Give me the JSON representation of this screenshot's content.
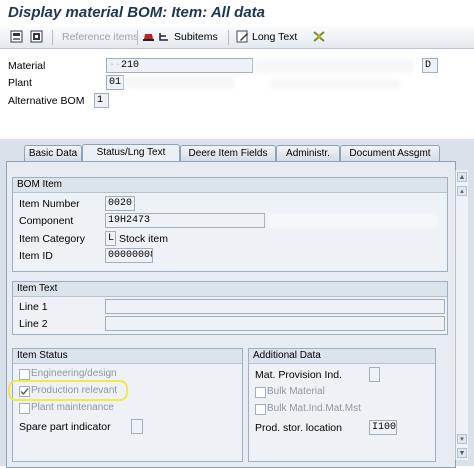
{
  "window": {
    "title": "Display material BOM: Item: All data"
  },
  "toolbar": {
    "reference_items": "Reference items",
    "subitems": "Subitems",
    "long_text": "Long Text"
  },
  "header": {
    "material_label": "Material",
    "material_value": "210",
    "material_right_value": "D",
    "plant_label": "Plant",
    "plant_value": "01",
    "alt_bom_label": "Alternative BOM",
    "alt_bom_value": "1"
  },
  "tabs": [
    {
      "label": "Basic Data",
      "active": false
    },
    {
      "label": "Status/Lng Text",
      "active": true
    },
    {
      "label": "Deere Item Fields",
      "active": false
    },
    {
      "label": "Administr.",
      "active": false
    },
    {
      "label": "Document Assgmt",
      "active": false
    }
  ],
  "bom_item": {
    "title": "BOM Item",
    "item_number_label": "Item Number",
    "item_number": "0020",
    "component_label": "Component",
    "component": "19H2473",
    "item_category_label": "Item Category",
    "item_category": "L",
    "item_category_text": "Stock item",
    "item_id_label": "Item ID",
    "item_id": "00000008"
  },
  "item_text": {
    "title": "Item Text",
    "line1_label": "Line 1",
    "line1": "",
    "line2_label": "Line 2",
    "line2": ""
  },
  "item_status": {
    "title": "Item Status",
    "engineering": "Engineering/design",
    "production": "Production relevant",
    "plant_maint": "Plant maintenance",
    "spare_part": "Spare part indicator"
  },
  "additional_data": {
    "title": "Additional Data",
    "mat_provision": "Mat. Provision Ind.",
    "bulk_material": "Bulk Material",
    "bulk_mat_ind": "Bulk Mat.Ind.Mat.Mst",
    "prod_stor_label": "Prod. stor. location",
    "prod_stor_value": "I100"
  },
  "colors": {
    "title": "#1c3654",
    "highlight": "#f2e84a",
    "panel": "#d9e1ea"
  }
}
